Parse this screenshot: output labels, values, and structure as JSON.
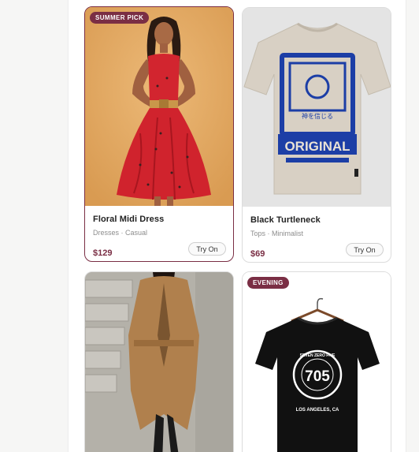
{
  "products": [
    {
      "title": "Floral Midi Dress",
      "subtitle": "Dresses · Casual",
      "price": "$129",
      "action": "Try On",
      "badge": "SUMMER PICK",
      "selected": true
    },
    {
      "title": "Black Turtleneck",
      "subtitle": "Tops · Minimalist",
      "price": "$69",
      "action": "Try On",
      "selected": false,
      "print_text": "ORIGINAL",
      "print_caption": "神を信じる"
    },
    {
      "title": "",
      "selected": false
    },
    {
      "badge": "EVENING",
      "selected": false,
      "print_ring": "SEVEN ZERO FIVE",
      "print_number": "705",
      "print_city": "LOS ANGELES, CA"
    }
  ],
  "colors": {
    "accent": "#7a2e44",
    "card1_background": "#e2a962",
    "card2_background": "#e4e4e4",
    "card3_background": "#b9b6ae",
    "card4_background": "#ffffff"
  }
}
